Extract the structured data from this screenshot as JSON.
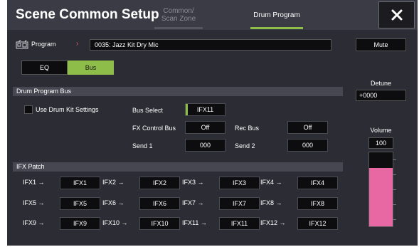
{
  "header": {
    "title": "Scene Common Setup",
    "tabs": [
      {
        "line1": "Common/",
        "line2": "Scan Zone",
        "active": false
      },
      {
        "label": "Drum Program",
        "active": true
      }
    ]
  },
  "program": {
    "label": "Program",
    "value": "0035: Jazz Kit Dry Mic"
  },
  "toggle": {
    "eq": "EQ",
    "bus": "Bus",
    "selected": "Bus"
  },
  "drum_program_bus": {
    "section_title": "Drum Program Bus",
    "use_drum_kit_settings": {
      "label": "Use Drum Kit Settings",
      "checked": false
    },
    "bus_select": {
      "label": "Bus Select",
      "value": "IFX11"
    },
    "fx_control_bus": {
      "label": "FX Control Bus",
      "value": "Off"
    },
    "rec_bus": {
      "label": "Rec Bus",
      "value": "Off"
    },
    "send1": {
      "label": "Send 1",
      "value": "000"
    },
    "send2": {
      "label": "Send 2",
      "value": "000"
    }
  },
  "ifx_patch": {
    "section_title": "IFX Patch",
    "rows": [
      [
        {
          "label": "IFX1 →",
          "value": "IFX1"
        },
        {
          "label": "IFX2 →",
          "value": "IFX2"
        },
        {
          "label": "IFX3 →",
          "value": "IFX3"
        },
        {
          "label": "IFX4 →",
          "value": "IFX4"
        }
      ],
      [
        {
          "label": "IFX5 →",
          "value": "IFX5"
        },
        {
          "label": "IFX6 →",
          "value": "IFX6"
        },
        {
          "label": "IFX7 →",
          "value": "IFX7"
        },
        {
          "label": "IFX8 →",
          "value": "IFX8"
        }
      ],
      [
        {
          "label": "IFX9 →",
          "value": "IFX9"
        },
        {
          "label": "IFX10 →",
          "value": "IFX10"
        },
        {
          "label": "IFX11 →",
          "value": "IFX11"
        },
        {
          "label": "IFX12 →",
          "value": "IFX12"
        }
      ]
    ]
  },
  "right": {
    "mute_label": "Mute",
    "detune_label": "Detune",
    "detune_value": "+0000",
    "volume_label": "Volume",
    "volume_value": "100",
    "volume_fraction": 0.787
  },
  "colors": {
    "accent_green": "#8fbd4a",
    "volume_pink": "#e868a4",
    "chevron_red": "#e0607a"
  },
  "icons": {
    "close": "close-icon",
    "program": "program-icon",
    "chevron": "chevron-right-icon"
  }
}
